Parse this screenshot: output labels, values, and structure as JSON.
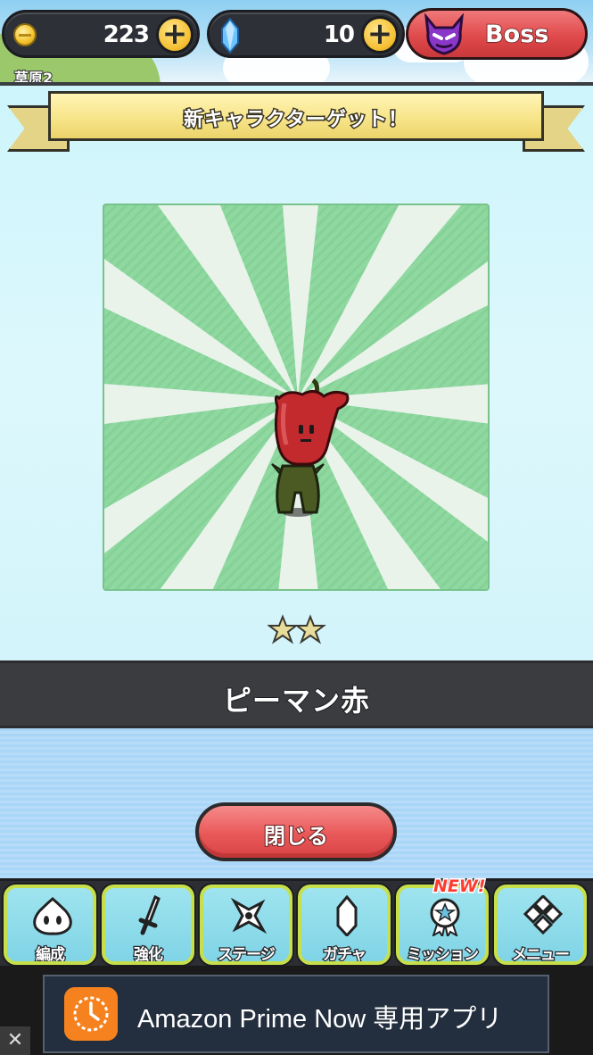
{
  "resources": {
    "coins": "223",
    "gems": "10",
    "boss_label": "Boss",
    "map_label": "草原2"
  },
  "dialog": {
    "title": "新キャラクターゲット！",
    "character_name": "ピーマン赤",
    "rarity_stars": 2,
    "close_label": "閉じる"
  },
  "nav": {
    "items": [
      {
        "label": "編成",
        "icon": "blob-icon"
      },
      {
        "label": "強化",
        "icon": "sword-icon"
      },
      {
        "label": "ステージ",
        "icon": "shuriken-icon"
      },
      {
        "label": "ガチャ",
        "icon": "crystal-icon"
      },
      {
        "label": "ミッション",
        "icon": "medal-icon"
      },
      {
        "label": "メニュー",
        "icon": "diamond-grid-icon"
      }
    ],
    "new_badge": "NEW!"
  },
  "ad": {
    "text": "Amazon Prime Now 専用アプリ",
    "close": "✕"
  },
  "colors": {
    "panel_bg": "#cdf5fb",
    "card_green": "#8fd9a1",
    "close_button": "#e95858",
    "boss_button": "#e04a4c",
    "nav_border": "#c6df4a"
  }
}
